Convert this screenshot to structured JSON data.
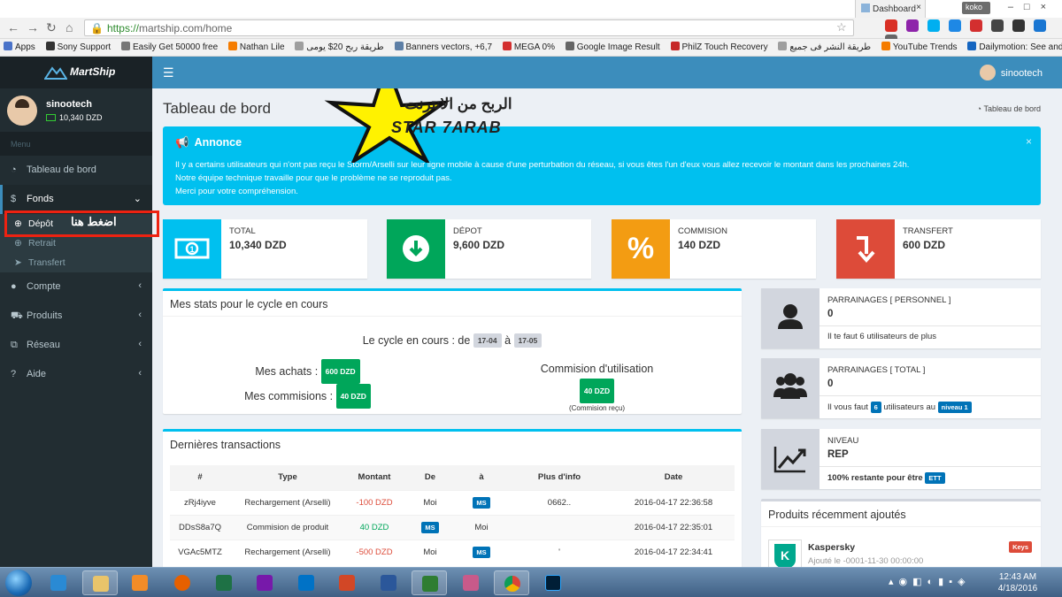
{
  "browser": {
    "tab_title": "Dashboard",
    "user_chip": "koko",
    "url_scheme": "https://",
    "url_rest": "martship.com/home",
    "bookmarks": [
      {
        "label": "Apps",
        "color": "#4a73c9"
      },
      {
        "label": "Sony Support",
        "color": "#333333"
      },
      {
        "label": "Easily Get 50000 free",
        "color": "#777777"
      },
      {
        "label": "Nathan Lile",
        "color": "#f57c00"
      },
      {
        "label": "طريقة ربح 20$ يومى",
        "color": "#9e9e9e"
      },
      {
        "label": "Banners vectors, +6,7",
        "color": "#5d7fa6"
      },
      {
        "label": "MEGA 0%",
        "color": "#d32f2f"
      },
      {
        "label": "Google Image Result",
        "color": "#666666"
      },
      {
        "label": "PhilZ Touch Recovery",
        "color": "#c62828"
      },
      {
        "label": "طريقة النشر فى جميع",
        "color": "#9e9e9e"
      },
      {
        "label": "YouTube Trends",
        "color": "#f57c00"
      },
      {
        "label": "Dailymotion: See and",
        "color": "#1565c0"
      }
    ]
  },
  "app": {
    "brand": "MartShip",
    "user_name": "sinootech",
    "user_balance": "10,340 DZD",
    "menu_header": "Menu",
    "menu": [
      {
        "label": "Tableau de bord",
        "icon": "dashboard-icon"
      },
      {
        "label": "Fonds",
        "icon": "dollar-icon"
      },
      {
        "label": "Compte",
        "icon": "user-icon"
      },
      {
        "label": "Produits",
        "icon": "cart-icon"
      },
      {
        "label": "Réseau",
        "icon": "network-icon"
      },
      {
        "label": "Aide",
        "icon": "question-icon"
      }
    ],
    "submenu": [
      {
        "label": "Dépôt",
        "icon": "plus-circle-icon"
      },
      {
        "label": "Retrait",
        "icon": "plus-circle-icon"
      },
      {
        "label": "Transfert",
        "icon": "send-icon"
      }
    ],
    "hint_overlay": "اضغط هنا"
  },
  "page": {
    "title": "Tableau de bord",
    "breadcrumb": "Tableau de bord",
    "watermark_ar": "الربح من الانترنت",
    "watermark_en": "STAR 7ARAB"
  },
  "announcement": {
    "title": "Annonce",
    "lines": [
      "Il y a certains utilisateurs qui n'ont pas reçu le Storm/Arselli sur leur ligne mobile à cause d'une perturbation du réseau, si vous êtes l'un d'eux vous allez recevoir le montant dans les prochaines 24h.",
      "Notre équipe technique travaille pour que le problème ne se reproduit pas.",
      "Merci pour votre compréhension."
    ]
  },
  "info_boxes": [
    {
      "label": "TOTAL",
      "value": "10,340 DZD",
      "color": "#00c0ef",
      "icon": "banknote-icon"
    },
    {
      "label": "DÉPOT",
      "value": "9,600 DZD",
      "color": "#00a65a",
      "icon": "arrow-down-circle-icon"
    },
    {
      "label": "COMMISION",
      "value": "140 DZD",
      "color": "#f39c12",
      "icon": "percent-icon"
    },
    {
      "label": "TRANSFERT",
      "value": "600 DZD",
      "color": "#dd4b39",
      "icon": "turn-down-arrow-icon"
    }
  ],
  "stats": {
    "title": "Mes stats pour le cycle en cours",
    "cycle_label": "Le cycle en cours : de",
    "cycle_from": "17-04",
    "cycle_sep": "à",
    "cycle_to": "17-05",
    "achats_label": "Mes achats :",
    "achats_value": "600 DZD",
    "commissions_label": "Mes commisions :",
    "commissions_value": "40 DZD",
    "usage_label": "Commision d'utilisation",
    "usage_value": "40 DZD",
    "usage_note": "(Commision reçu)"
  },
  "transactions": {
    "title": "Dernières transactions",
    "columns": [
      "#",
      "Type",
      "Montant",
      "De",
      "à",
      "Plus d'info",
      "Date"
    ],
    "rows": [
      {
        "id": "zRj4iyve",
        "type": "Rechargement (Arselli)",
        "amount": "-100 DZD",
        "from": "Moi",
        "to": "MS",
        "info": "0662..",
        "date": "2016-04-17 22:36:58",
        "sign": "neg"
      },
      {
        "id": "DDsS8a7Q",
        "type": "Commision de produit",
        "amount": "40 DZD",
        "from": "MS",
        "to": "Moi",
        "info": "",
        "date": "2016-04-17 22:35:01",
        "sign": "pos"
      },
      {
        "id": "VGAc5MTZ",
        "type": "Rechargement (Arselli)",
        "amount": "-500 DZD",
        "from": "Moi",
        "to": "MS",
        "info": "'",
        "date": "2016-04-17 22:34:41",
        "sign": "neg"
      }
    ]
  },
  "side_stats": {
    "perso_title": "PARRAINAGES [ PERSONNEL ]",
    "perso_value": "0",
    "perso_note": "Il te faut 6 utilisateurs de plus",
    "total_title": "PARRAINAGES [ TOTAL ]",
    "total_value": "0",
    "total_note_a": "Il vous faut",
    "total_note_count": "6",
    "total_note_b": "utilisateurs au",
    "total_note_level": "niveau 1",
    "level_title": "NIVEAU",
    "level_value": "REP",
    "level_note": "100% restante pour être",
    "level_next": "ETT"
  },
  "products": {
    "title": "Produits récemment ajoutés",
    "item_name": "Kaspersky",
    "item_date": "Ajouté le -0001-11-30 00:00:00",
    "item_badge": "Keys"
  },
  "taskbar": {
    "time": "12:43 AM",
    "date": "4/18/2016"
  }
}
